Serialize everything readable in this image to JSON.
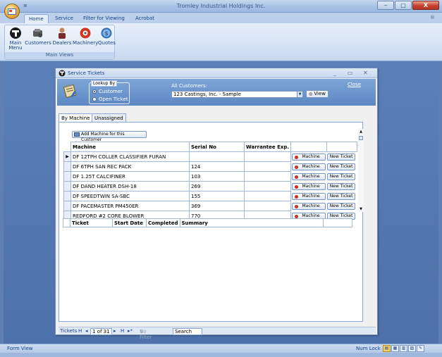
{
  "titlebar": {
    "title": "Tromley Industrial Holdings Inc.",
    "qat_glyph": "≡",
    "minimize": "‒",
    "maximize": "□",
    "close": "X"
  },
  "ribbon_tabs": [
    "Home",
    "Service",
    "Filter for Viewing",
    "Acrobat"
  ],
  "ribbon_help": "®",
  "ribbon": {
    "group_label": "Main Views",
    "buttons": [
      {
        "label_line1": "Main",
        "label_line2": "Menu",
        "icon": "tromley-logo-icon"
      },
      {
        "label_line1": "Customers",
        "label_line2": "",
        "icon": "customers-icon"
      },
      {
        "label_line1": "Dealers",
        "label_line2": "",
        "icon": "dealers-icon"
      },
      {
        "label_line1": "Machinery",
        "label_line2": "",
        "icon": "machinery-icon"
      },
      {
        "label_line1": "Quotes",
        "label_line2": "",
        "icon": "quotes-icon"
      }
    ]
  },
  "form": {
    "title": "Service Tickets",
    "controls": {
      "minimize": "_",
      "restore": "▭",
      "close": "✕"
    },
    "lookup_by": {
      "legend": "Lookup By",
      "options": [
        {
          "label": "Customer",
          "selected": true
        },
        {
          "label": "Open Ticket",
          "selected": false
        }
      ]
    },
    "all_customers_label": "All Customers:",
    "customer_value": "123 Castings, Inc. - Sample",
    "view_button": "View",
    "close_link": "Close",
    "tabs": [
      {
        "label": "By Machine",
        "active": true
      },
      {
        "label": "Unassigned",
        "active": false
      }
    ],
    "add_machine_button": "Add Machine for this Customer",
    "machine_grid": {
      "headers": [
        "Machine",
        "Serial No",
        "Warrantee Exp."
      ],
      "machine_button": "Machine",
      "new_ticket_button": "New Ticket",
      "rows": [
        {
          "machine": "DF 12TPH COLLER CLASSIFIER FURAN",
          "serial": "",
          "warranty": "",
          "current": true
        },
        {
          "machine": "DF 6TPH SAN REC PACK",
          "serial": "124",
          "warranty": "",
          "current": false
        },
        {
          "machine": "DF 1.25T CALCIFINER",
          "serial": "103",
          "warranty": "",
          "current": false
        },
        {
          "machine": "DF DAND HEATER DSH-18",
          "serial": "269",
          "warranty": "",
          "current": false
        },
        {
          "machine": "DF SPEEDTWIN SA-SBC",
          "serial": "155",
          "warranty": "",
          "current": false
        },
        {
          "machine": "DF PACEMASTER PM450ER",
          "serial": "369",
          "warranty": "",
          "current": false
        },
        {
          "machine": "REDFORD #2 CORE BLOWER",
          "serial": "770",
          "warranty": "",
          "current": false
        }
      ]
    },
    "ticket_grid": {
      "headers": [
        "Ticket",
        "Start Date",
        "Completed",
        "Summary"
      ]
    },
    "navbar": {
      "label": "Tickets",
      "first": "H",
      "prev": "◂",
      "record": "1 of 31",
      "next": "▸",
      "last": "H",
      "new": "▸*",
      "filter": "No Filter",
      "search": "Search"
    }
  },
  "statusbar": {
    "left": "Form View",
    "right": "Num Lock"
  },
  "colors": {
    "ribbon_text": "#15428b",
    "header_blue": "#6a95cf",
    "workspace": "#5476b0"
  }
}
